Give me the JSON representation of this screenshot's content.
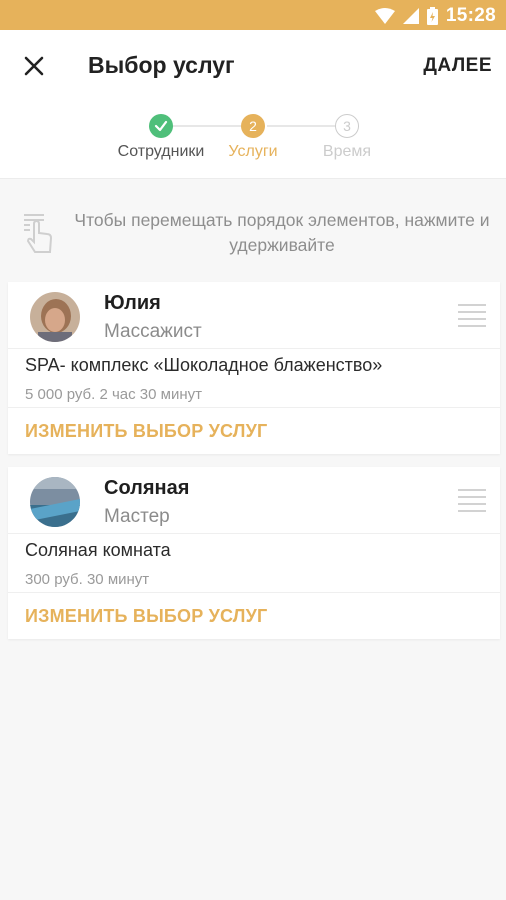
{
  "status_bar": {
    "time": "15:28",
    "color": "#e6b25b"
  },
  "app_bar": {
    "title": "Выбор услуг",
    "next_label": "ДАЛЕЕ",
    "close_icon": "close-icon"
  },
  "stepper": {
    "steps": [
      {
        "label": "Сотрудники",
        "number": "",
        "state": "done"
      },
      {
        "label": "Услуги",
        "number": "2",
        "state": "active"
      },
      {
        "label": "Время",
        "number": "3",
        "state": "inactive"
      }
    ],
    "colors": {
      "done": "#4fbf7a",
      "active": "#e6b25b",
      "inactive": "#cccccc"
    }
  },
  "hint": {
    "text": "Чтобы перемещать порядок элементов, нажмите и удерживайте"
  },
  "cards": [
    {
      "employee_name": "Юлия",
      "employee_role": "Массажист",
      "service_name": "SPA- комплекс «Шоколадное блаженство»",
      "service_meta": "5 000 руб.   2 час 30 минут",
      "change_label": "ИЗМЕНИТЬ ВЫБОР УСЛУГ"
    },
    {
      "employee_name": "Соляная",
      "employee_role": "Мастер",
      "service_name": "Соляная комната",
      "service_meta": "300 руб.   30 минут",
      "change_label": "ИЗМЕНИТЬ ВЫБОР УСЛУГ"
    }
  ]
}
